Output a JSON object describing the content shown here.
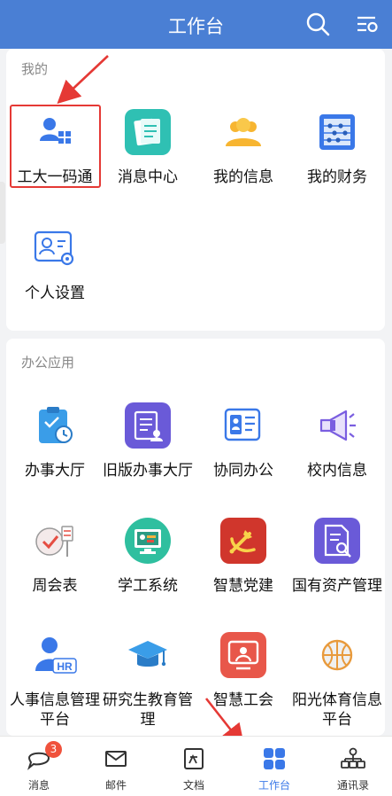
{
  "header": {
    "title": "工作台"
  },
  "sections": {
    "mine": {
      "title": "我的",
      "apps": [
        {
          "label": "工大一码通",
          "icon": "qr-id-icon"
        },
        {
          "label": "消息中心",
          "icon": "message-center-icon"
        },
        {
          "label": "我的信息",
          "icon": "my-info-icon"
        },
        {
          "label": "我的财务",
          "icon": "abacus-icon"
        },
        {
          "label": "个人设置",
          "icon": "personal-settings-icon"
        }
      ]
    },
    "office": {
      "title": "办公应用",
      "apps": [
        {
          "label": "办事大厅",
          "icon": "service-hall-icon"
        },
        {
          "label": "旧版办事大厅",
          "icon": "old-service-hall-icon"
        },
        {
          "label": "协同办公",
          "icon": "collaboration-icon"
        },
        {
          "label": "校内信息",
          "icon": "megaphone-icon"
        },
        {
          "label": "周会表",
          "icon": "meeting-board-icon"
        },
        {
          "label": "学工系统",
          "icon": "student-system-icon"
        },
        {
          "label": "智慧党建",
          "icon": "party-emblem-icon"
        },
        {
          "label": "国有资产管理",
          "icon": "asset-search-icon"
        },
        {
          "label": "人事信息管理平台",
          "icon": "hr-icon"
        },
        {
          "label": "研究生教育管理",
          "icon": "graduate-cap-icon"
        },
        {
          "label": "智慧工会",
          "icon": "union-icon"
        },
        {
          "label": "阳光体育信息平台",
          "icon": "basketball-icon"
        }
      ]
    }
  },
  "tabbar": {
    "items": [
      {
        "label": "消息",
        "badge": "3"
      },
      {
        "label": "邮件"
      },
      {
        "label": "文档"
      },
      {
        "label": "工作台"
      },
      {
        "label": "通讯录"
      }
    ]
  },
  "colors": {
    "header": "#4a7fd4",
    "accent": "#3a78e8",
    "annotation": "#e53935"
  }
}
